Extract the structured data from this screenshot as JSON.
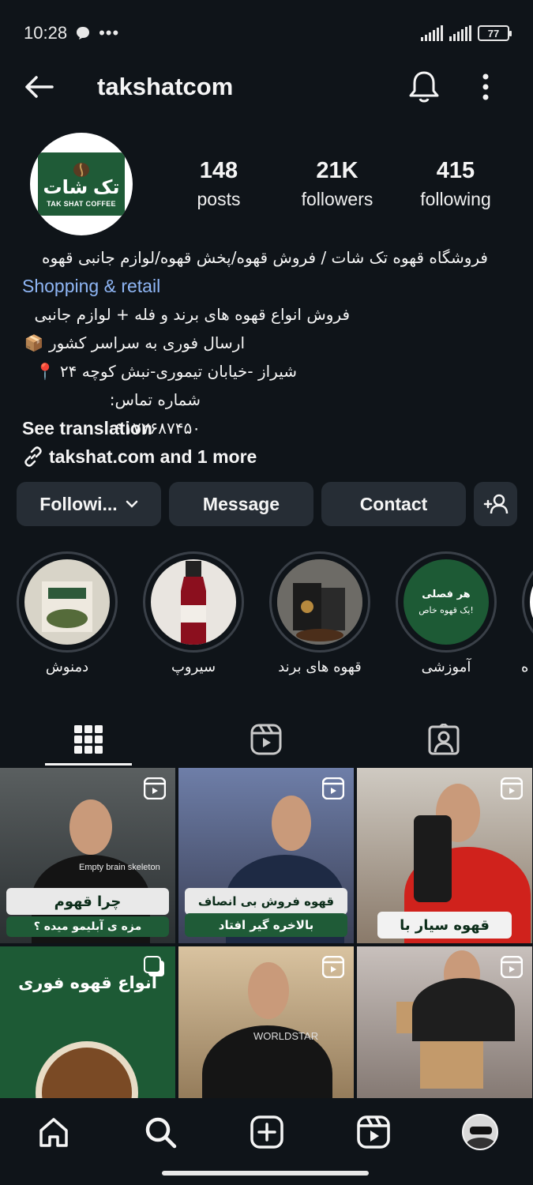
{
  "status_bar": {
    "time": "10:28",
    "battery": "77"
  },
  "header": {
    "username": "takshatcom"
  },
  "profile": {
    "logo_text_fa": "تک شات",
    "logo_text_en": "TAK SHAT COFFEE",
    "stats": [
      {
        "num": "148",
        "label": "posts"
      },
      {
        "num": "21K",
        "label": "followers"
      },
      {
        "num": "415",
        "label": "following"
      }
    ]
  },
  "bio": {
    "name_line": "فروشگاه قهوه تک شات / فروش قهوه/پخش قهوه/لوازم جانبی قهوه",
    "category": "Shopping & retail",
    "line1": "فروش انواع قهوه های برند و فله + لوازم جانبی",
    "line2": "ارسال فوری به سراسر کشور 📦",
    "line3": "شیراز -خیابان تیموری-نبش کوچه ۲۴ 📍",
    "line4": "شماره تماس: ۰۹۱۷۷۶۸۷۴۵۰",
    "see_translation": "See translation",
    "link": "takshat.com and 1 more"
  },
  "actions": {
    "following": "Followi...",
    "message": "Message",
    "contact": "Contact"
  },
  "highlights": [
    {
      "caption": "دمنوش",
      "color": "#d8d4c8"
    },
    {
      "caption": "سیروپ",
      "color": "#e9e5e0"
    },
    {
      "caption": "قهوه های برند",
      "color": "#5a5a5a"
    },
    {
      "caption": "آموزشی",
      "color": "#1d5a35",
      "title": "هر فصلی",
      "subtitle": "یک قهوه خاص!"
    },
    {
      "caption": "ه",
      "color": "#ffffff"
    }
  ],
  "grid": [
    {
      "banner": "چرا قهوم",
      "sub": "مزه ی آبلیمو میده ؟",
      "shirt_text": "Empty brain skeleton"
    },
    {
      "banner": "قهوه فروش بی انصاف",
      "sub": "بالاخره گیر افتاد"
    },
    {
      "banner": "قهوه سیار با"
    },
    {
      "banner": "انواع قهوه فوری"
    },
    {
      "shirt_text": "WORLDSTAR"
    },
    {}
  ]
}
